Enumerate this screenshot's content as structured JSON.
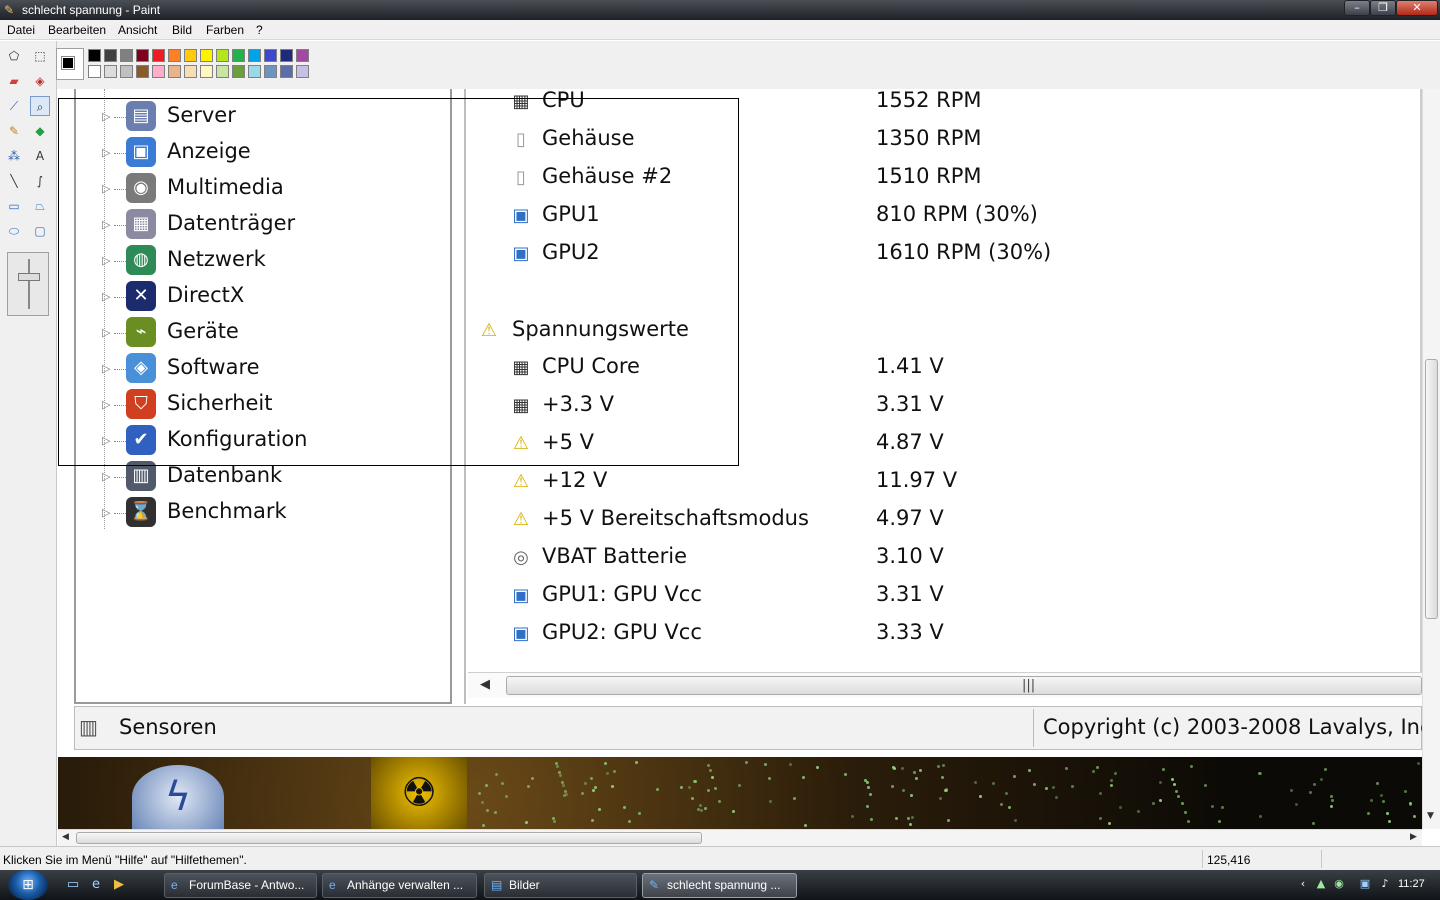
{
  "window": {
    "title": "schlecht spannung - Paint",
    "minimize": "–",
    "maximize": "❐",
    "close": "✕"
  },
  "menu": [
    "Datei",
    "Bearbeiten",
    "Ansicht",
    "Bild",
    "Farben",
    "?"
  ],
  "palette": {
    "primary_color": "#000000",
    "secondary_color": "#ffffff",
    "row1": [
      "#000000",
      "#404040",
      "#808080",
      "#800020",
      "#ed1c24",
      "#ff7f27",
      "#ffc90e",
      "#fff200",
      "#b5e61d",
      "#22b14c",
      "#00a2e8",
      "#3f48cc",
      "#1f2a7a",
      "#a349a4"
    ],
    "row2": [
      "#ffffff",
      "#dcdcdc",
      "#c0c0c0",
      "#8b5a2b",
      "#ffaec9",
      "#e8b48a",
      "#f5deb3",
      "#fff8c0",
      "#c8e6a0",
      "#6b9e3c",
      "#99d9ea",
      "#7092be",
      "#5b6ea8",
      "#c8bfe7"
    ]
  },
  "tools": [
    "free-select",
    "rect-select",
    "eraser",
    "fill",
    "picker",
    "magnifier",
    "pencil",
    "brush",
    "airbrush",
    "text",
    "line",
    "curve",
    "rectangle",
    "polygon",
    "ellipse",
    "rounded-rect"
  ],
  "tree": [
    {
      "label": "Server",
      "icon": "server-icon",
      "color": "#6a7fb0"
    },
    {
      "label": "Anzeige",
      "icon": "monitor-icon",
      "color": "#3a7bd5"
    },
    {
      "label": "Multimedia",
      "icon": "speaker-icon",
      "color": "#7a7a7a"
    },
    {
      "label": "Datenträger",
      "icon": "disk-icon",
      "color": "#8a8aa0"
    },
    {
      "label": "Netzwerk",
      "icon": "network-icon",
      "color": "#2e8b57"
    },
    {
      "label": "DirectX",
      "icon": "directx-icon",
      "color": "#1c2a6e"
    },
    {
      "label": "Geräte",
      "icon": "devices-icon",
      "color": "#6b8e23"
    },
    {
      "label": "Software",
      "icon": "software-icon",
      "color": "#4a90d9"
    },
    {
      "label": "Sicherheit",
      "icon": "shield-icon",
      "color": "#d04020"
    },
    {
      "label": "Konfiguration",
      "icon": "config-icon",
      "color": "#3060c0"
    },
    {
      "label": "Datenbank",
      "icon": "database-icon",
      "color": "#505a6a"
    },
    {
      "label": "Benchmark",
      "icon": "hourglass-icon",
      "color": "#303030"
    }
  ],
  "sensors": {
    "fans": [
      {
        "label": "CPU",
        "value": "1552 RPM",
        "icon": "chip-icon"
      },
      {
        "label": "Gehäuse",
        "value": "1350 RPM",
        "icon": "case-icon"
      },
      {
        "label": "Gehäuse #2",
        "value": "1510 RPM",
        "icon": "case-icon"
      },
      {
        "label": "GPU1",
        "value": "810 RPM  (30%)",
        "icon": "gpu-monitor-icon"
      },
      {
        "label": "GPU2",
        "value": "1610 RPM  (30%)",
        "icon": "gpu-monitor-icon"
      }
    ],
    "section_title": "Spannungswerte",
    "voltages": [
      {
        "label": "CPU Core",
        "value": "1.41 V",
        "icon": "chip-icon"
      },
      {
        "label": "+3.3 V",
        "value": "3.31 V",
        "icon": "chip-icon"
      },
      {
        "label": "+5 V",
        "value": "4.87 V",
        "icon": "voltage-warning-icon"
      },
      {
        "label": "+12 V",
        "value": "11.97 V",
        "icon": "voltage-warning-icon"
      },
      {
        "label": "+5 V Bereitschaftsmodus",
        "value": "4.97 V",
        "icon": "voltage-warning-icon"
      },
      {
        "label": "VBAT Batterie",
        "value": "3.10 V",
        "icon": "battery-icon"
      },
      {
        "label": "GPU1: GPU Vcc",
        "value": "3.31 V",
        "icon": "gpu-monitor-icon"
      },
      {
        "label": "GPU2: GPU Vcc",
        "value": "3.33 V",
        "icon": "gpu-monitor-icon"
      }
    ]
  },
  "inner_status": {
    "left": "Sensoren",
    "right": "Copyright (c) 2003-2008 Lavalys, Inc"
  },
  "paint_status": {
    "hint": "Klicken Sie im Menü \"Hilfe\" auf \"Hilfethemen\".",
    "coords": "125,416"
  },
  "taskbar": {
    "buttons": [
      {
        "label": "ForumBase - Antwo...",
        "icon": "ie-icon"
      },
      {
        "label": "Anhänge verwalten ...",
        "icon": "ie-icon"
      },
      {
        "label": "Bilder",
        "icon": "folder-icon"
      },
      {
        "label": "schlecht spannung ...",
        "icon": "paint-icon"
      }
    ],
    "clock": "11:27"
  }
}
